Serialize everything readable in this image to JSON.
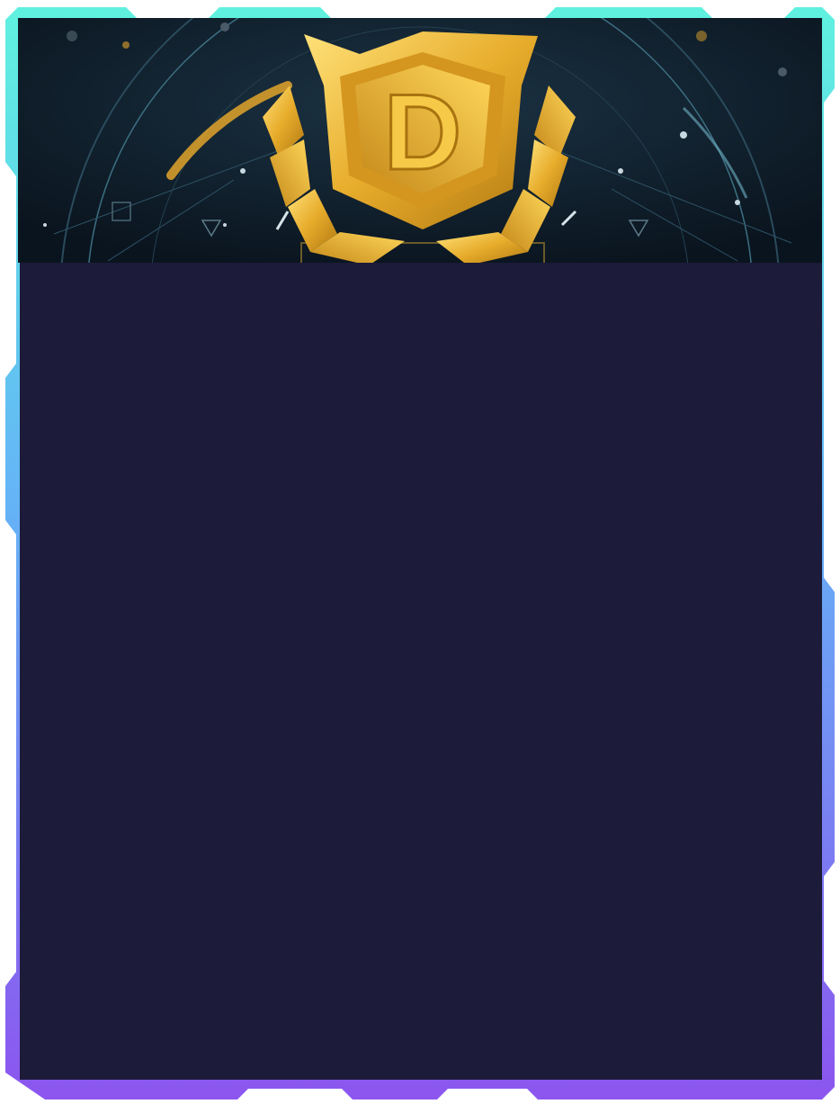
{
  "card": {
    "emblem_letter": "D",
    "colors": {
      "border_top": "#5ff1df",
      "border_mid": "#64b4f6",
      "border_bottom": "#8c55ef",
      "panel_background": "#1c1b3a",
      "header_background": "#0d1a26",
      "gold_light": "#ffd75a",
      "gold_mid": "#e7ac2b",
      "gold_dark": "#b07812",
      "hud_line": "#3c6f82"
    },
    "icons": [
      "emblem-shield-icon",
      "laurel-left-icon",
      "laurel-right-icon"
    ]
  },
  "panel": {
    "text": ""
  }
}
